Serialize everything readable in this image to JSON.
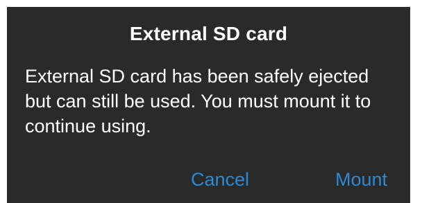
{
  "dialog": {
    "title": "External SD card",
    "message": "External SD card has been safely ejected but can still be used. You must mount it to continue using.",
    "buttons": {
      "cancel_label": "Cancel",
      "mount_label": "Mount"
    }
  },
  "colors": {
    "dialog_background": "#2a2a2a",
    "text": "#ffffff",
    "accent": "#2a8ad4"
  }
}
